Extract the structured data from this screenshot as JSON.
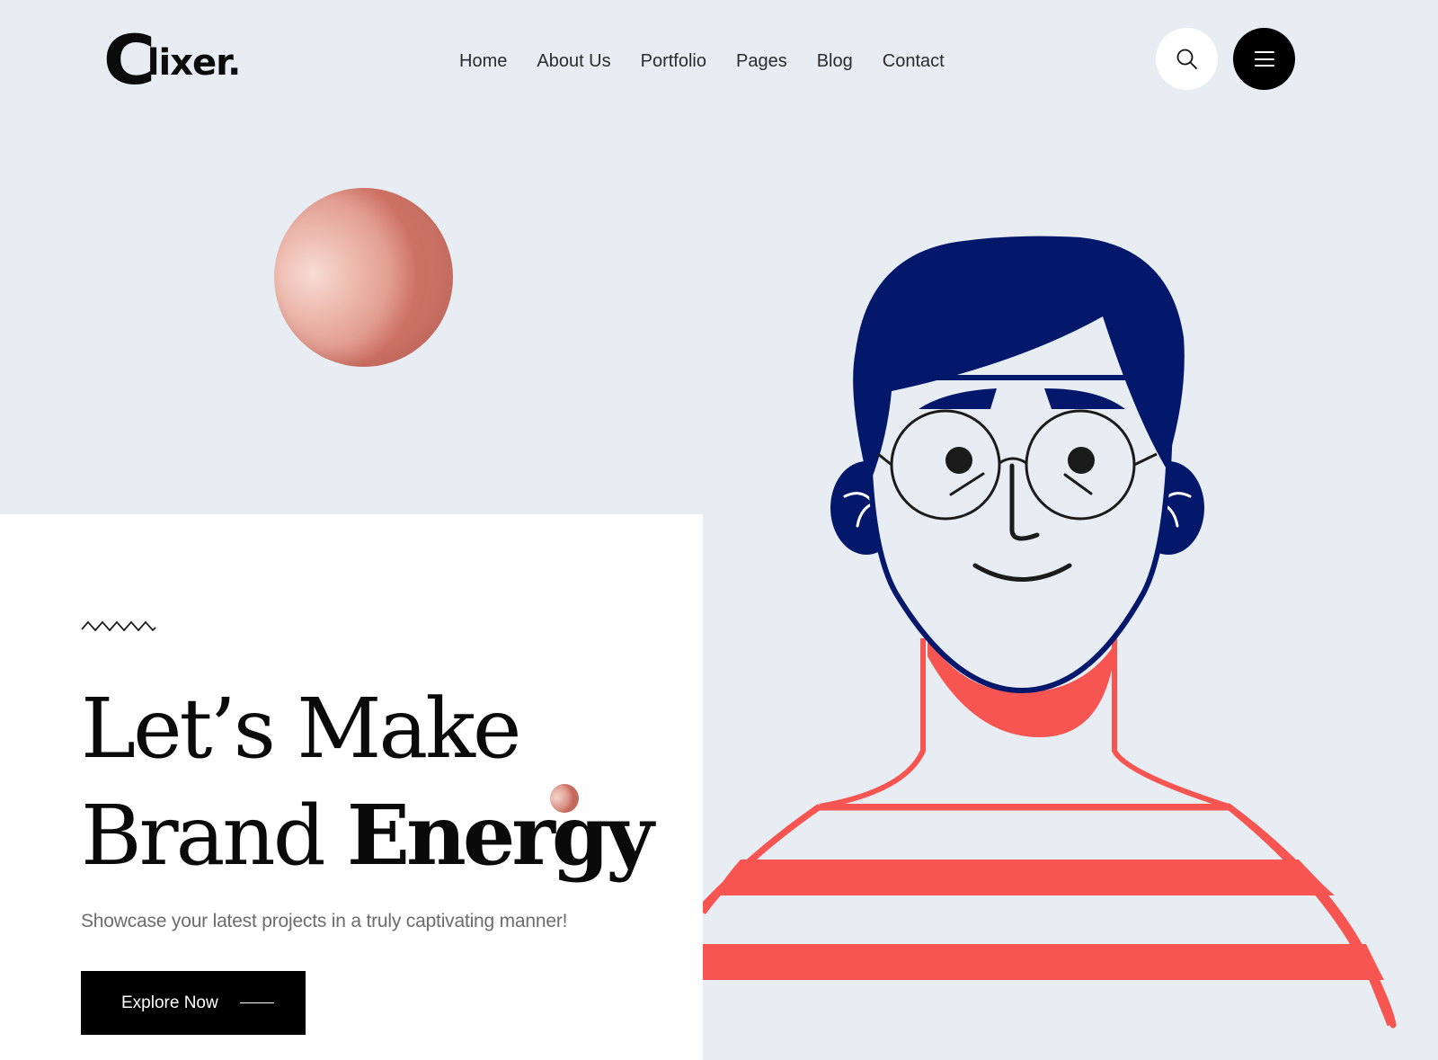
{
  "brand": {
    "logo_initial": "C",
    "logo_rest": "lixer.",
    "colors": {
      "background": "#e8edf4",
      "text": "#0a0a0a",
      "accent_coral": "#f75552",
      "hair_navy": "#03186b",
      "sphere_pink": "#e29f92"
    }
  },
  "nav": {
    "items": [
      {
        "label": "Home"
      },
      {
        "label": "About Us"
      },
      {
        "label": "Portfolio"
      },
      {
        "label": "Pages"
      },
      {
        "label": "Blog"
      },
      {
        "label": "Contact"
      }
    ]
  },
  "header_actions": {
    "search_icon": "search-icon",
    "menu_icon": "hamburger-menu-icon"
  },
  "hero": {
    "decoration_icon": "zigzag-icon",
    "headline_line1": "Let’s Make",
    "headline_line2_regular": "Brand ",
    "headline_line2_bold": "Energy",
    "subtitle": "Showcase your latest projects in a truly captivating manner!",
    "cta_label": "Explore Now",
    "cta_icon": "long-arrow-line-icon"
  },
  "illustration": {
    "subject": "man-with-round-glasses-striped-shirt"
  }
}
